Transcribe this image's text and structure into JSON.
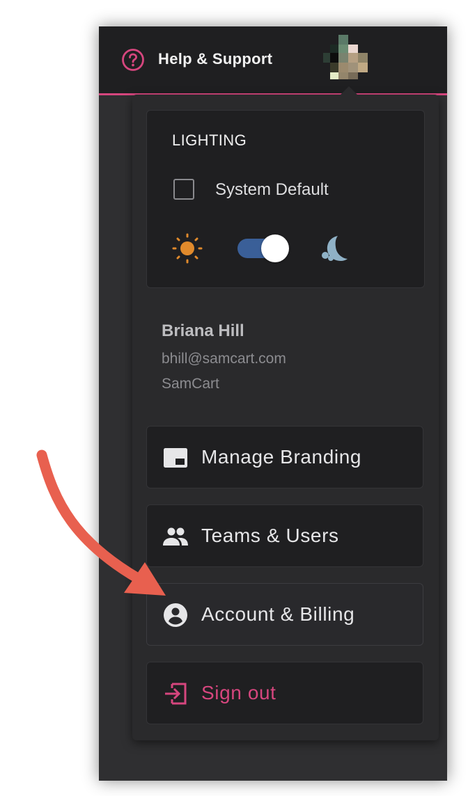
{
  "topbar": {
    "help_label": "Help & Support",
    "help_icon": "question-circle-icon",
    "accent_color": "#d6467e"
  },
  "lighting": {
    "title": "LIGHTING",
    "system_default_label": "System Default",
    "system_default_checked": false,
    "dark_mode_on": true,
    "sun_color": "#e08a2c",
    "toggle_color": "#3a5f98",
    "moon_color": "#8fb1c6"
  },
  "user": {
    "name": "Briana Hill",
    "email": "bhill@samcart.com",
    "company": "SamCart"
  },
  "menu": {
    "items": [
      {
        "label": "Manage Branding",
        "icon": "branding-icon"
      },
      {
        "label": "Teams & Users",
        "icon": "people-icon"
      },
      {
        "label": "Account & Billing",
        "icon": "account-circle-icon"
      },
      {
        "label": "Sign out",
        "icon": "sign-out-icon"
      }
    ]
  },
  "annotation": {
    "arrow_color": "#e8604f"
  }
}
